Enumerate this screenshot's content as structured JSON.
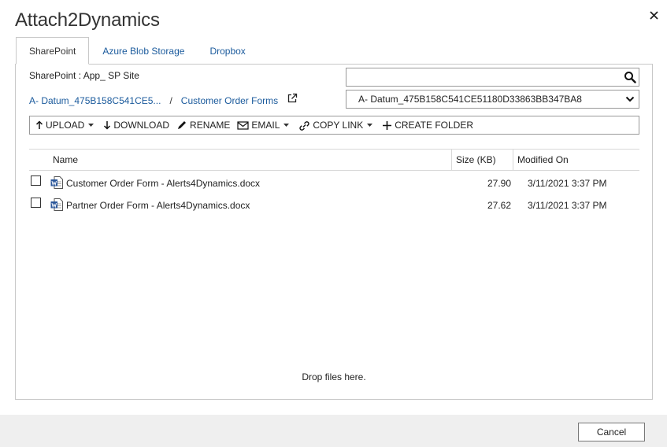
{
  "window": {
    "title": "Attach2Dynamics"
  },
  "tabs": [
    {
      "label": "SharePoint",
      "active": true
    },
    {
      "label": "Azure Blob Storage",
      "active": false
    },
    {
      "label": "Dropbox",
      "active": false
    }
  ],
  "sharepoint": {
    "site_label": "SharePoint : App_ SP Site",
    "search": {
      "value": "",
      "placeholder": ""
    },
    "breadcrumb": {
      "root": "A- Datum_475B158C541CE5...",
      "separator": "/",
      "current": "Customer Order Forms"
    },
    "folder_select": {
      "selected": "A- Datum_475B158C541CE51180D33863BB347BA8"
    }
  },
  "toolbar": {
    "upload": "UPLOAD",
    "download": "DOWNLOAD",
    "rename": "RENAME",
    "email": "EMAIL",
    "copy_link": "COPY LINK",
    "create_folder": "CREATE FOLDER"
  },
  "grid": {
    "columns": {
      "name": "Name",
      "size": "Size (KB)",
      "modified": "Modified On"
    },
    "rows": [
      {
        "name": "Customer Order Form - Alerts4Dynamics.docx",
        "size": "27.90",
        "modified": "3/11/2021 3:37 PM"
      },
      {
        "name": "Partner Order Form - Alerts4Dynamics.docx",
        "size": "27.62",
        "modified": "3/11/2021 3:37 PM"
      }
    ]
  },
  "drop_zone": {
    "text": "Drop files here."
  },
  "footer": {
    "cancel": "Cancel"
  },
  "colors": {
    "link": "#1a5a9c",
    "border": "#c8c8c8",
    "footer_bg": "#efefef",
    "word_icon": "#2b579a"
  },
  "icons": {
    "close": "close-icon",
    "search": "search-icon",
    "open_external": "open-external-icon",
    "chevron": "chevron-down-icon",
    "upload": "arrow-up-icon",
    "download": "arrow-down-icon",
    "rename": "pencil-icon",
    "email": "envelope-icon",
    "copy_link": "link-icon",
    "create_folder": "plus-icon",
    "document": "word-document-icon"
  }
}
